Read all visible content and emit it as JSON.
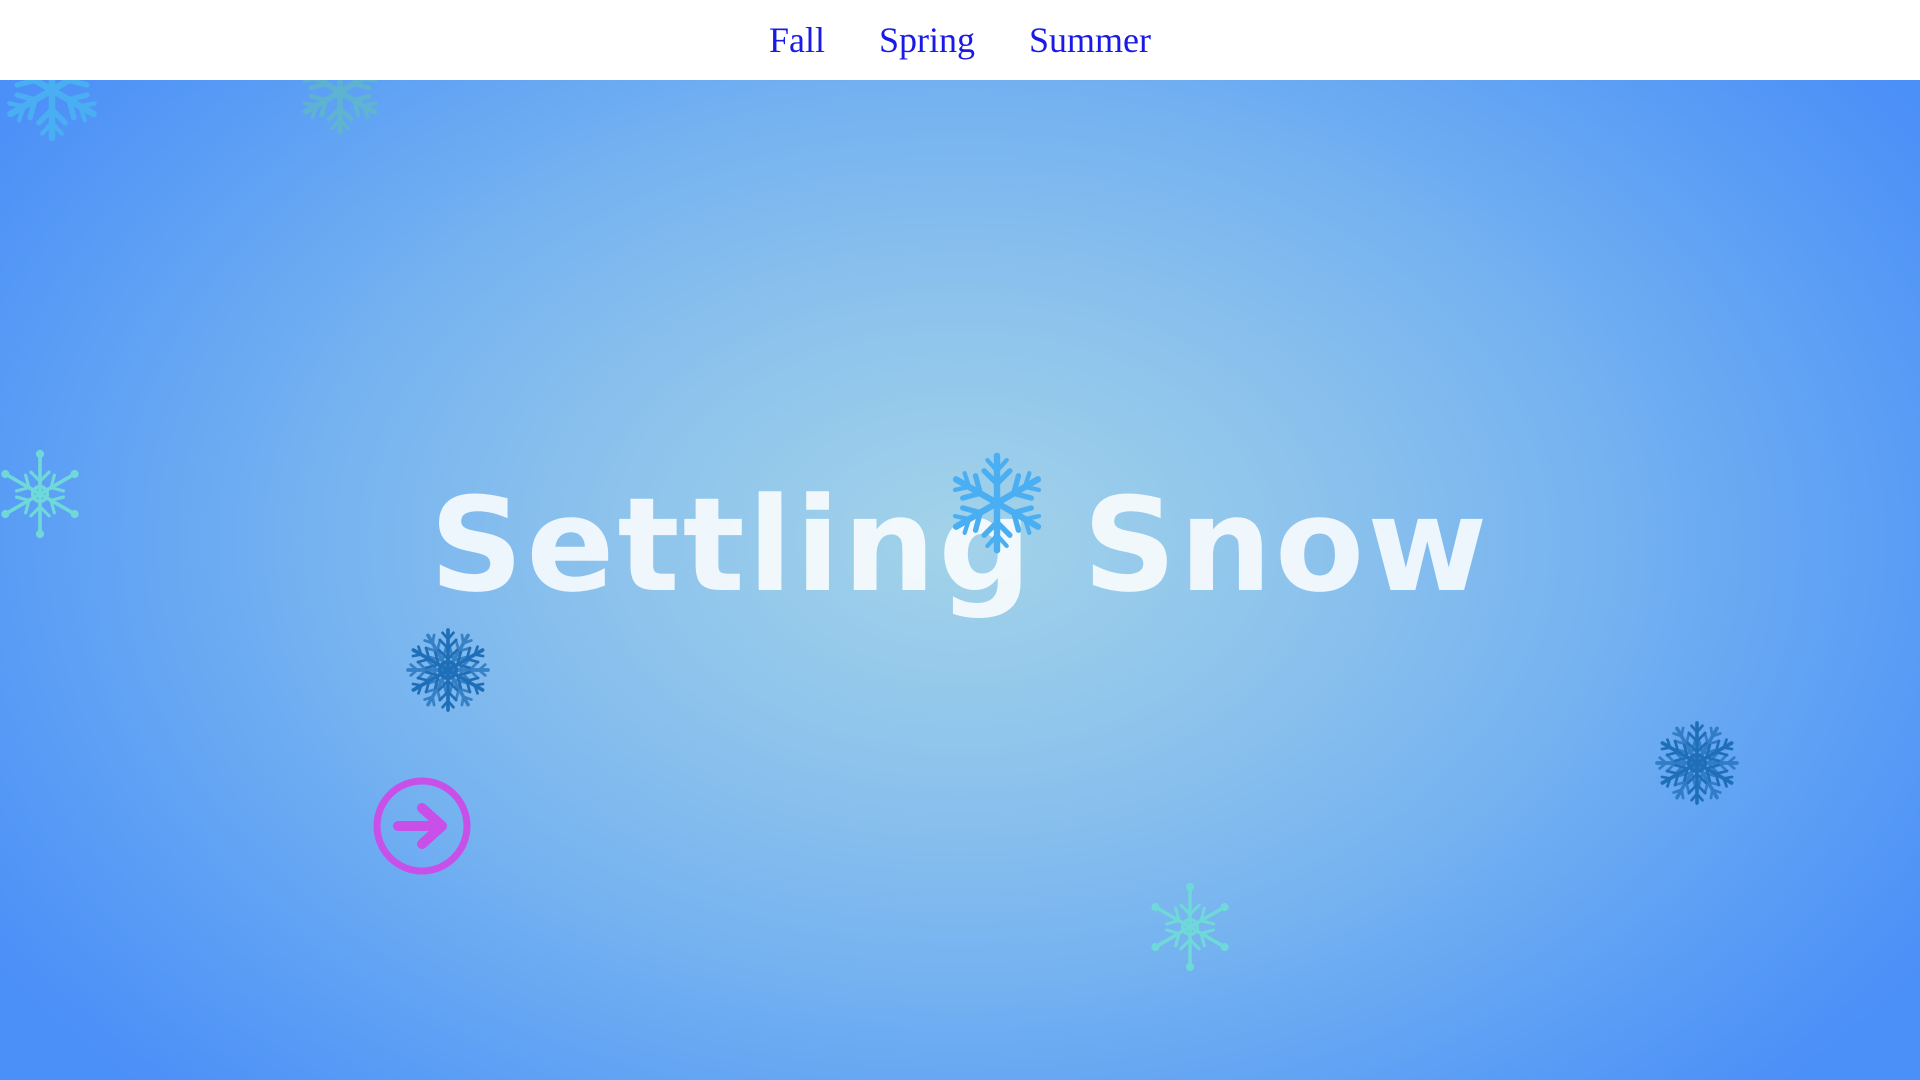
{
  "nav": {
    "items": [
      {
        "label": "Fall"
      },
      {
        "label": "Spring"
      },
      {
        "label": "Summer"
      }
    ],
    "link_color": "#1a1ae6"
  },
  "hero": {
    "title": "Settling Snow"
  },
  "colors": {
    "bg_center": "#a3d3ea",
    "bg_edge": "#4b8ff8",
    "flake_light_blue": "#4aaef2",
    "flake_teal": "#6fd8d8",
    "flake_dark_blue": "#1f6fb8",
    "accent_purple": "#c84fe8"
  },
  "icons": {
    "next": "arrow-right-circle-icon",
    "flake": "snowflake-icon"
  }
}
